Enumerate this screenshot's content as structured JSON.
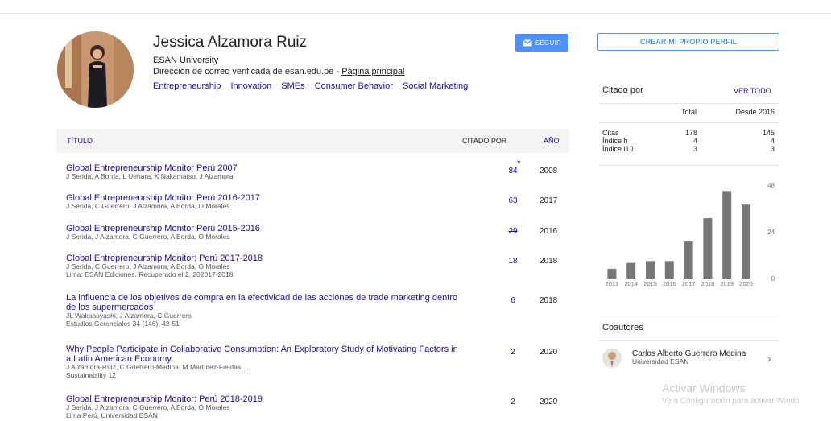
{
  "profile": {
    "name": "Jessica Alzamora Ruiz",
    "affiliation": "ESAN University",
    "email_text": "Dirección de correo verificada de esan.edu.pe - ",
    "homepage_label": "Página principal",
    "interests": [
      "Entrepreneurship",
      "Innovation",
      "SMEs",
      "Consumer Behavior",
      "Social Marketing"
    ],
    "follow_label": "SEGUIR"
  },
  "table": {
    "col_title": "TÍTULO",
    "col_cited": "CITADO POR",
    "col_year": "AÑO",
    "rows": [
      {
        "title": "Global Entrepreneurship Monitor Perú 2007",
        "authors": "J Serida, A Borda, L Uehara, K Nakamatsu, J Alzamora",
        "source": "",
        "cited": "84",
        "star": "*",
        "year": "2008"
      },
      {
        "title": "Global Entrepreneurship Monitor Perú 2016-2017",
        "authors": "J Serida, C Guerrero, J Alzamora, A Borda, O Morales",
        "source": "",
        "cited": "63",
        "year": "2017"
      },
      {
        "title": "Global Entrepreneurship Monitor Perú 2015-2016",
        "authors": "J Serida, J Alzamora, C Guerrero, A Borda, O Morales",
        "source": "",
        "cited": "29",
        "year": "2016"
      },
      {
        "title": "Global Entrepreneurship Monitor: Perú 2017-2018",
        "authors": "J Serida, C Guerrero, J Alzamora, A Borda, O Morales",
        "source": "Lima: ESAN Ediciones. Recuperado el 2, 202017-2018",
        "cited": "18",
        "year": "2018"
      },
      {
        "title": "La influencia de los objetivos de compra en la efectividad de las acciones de trade marketing dentro de los supermercados",
        "authors": "JL Wakabayashi, J Alzamora, C Guerrero",
        "source": "Estudios Gerenciales 34 (146), 42-51",
        "cited": "6",
        "year": "2018"
      },
      {
        "title": "Why People Participate in Collaborative Consumption: An Exploratory Study of Motivating Factors in a Latin American Economy",
        "authors": "J Alzamora-Ruiz, C Guerrero-Medina, M Martínez-Fiestas, ...",
        "source": "Sustainability 12",
        "cited": "2",
        "year": "2020"
      },
      {
        "title": "Global Entrepreneurship Monitor: Perú 2018-2019",
        "authors": "J Serida, J Alzamora, C Guerrero, A Borda, O Morales",
        "source": "Lima Perú, Universidad ESAN",
        "cited": "2",
        "year": "2020"
      }
    ]
  },
  "sidebar": {
    "create_label": "CREAR MI PROPIO PERFIL",
    "cited_by_title": "Citado por",
    "see_all_label": "VER TODO",
    "col_total": "Total",
    "col_since": "Desde 2016",
    "stats": [
      {
        "label": "Citas",
        "total": "178",
        "since": "145"
      },
      {
        "label": "Índice h",
        "total": "4",
        "since": "4"
      },
      {
        "label": "Índice i10",
        "total": "3",
        "since": "3"
      }
    ],
    "coauthors_title": "Coautores",
    "coauthor_name": "Carlos Alberto Guerrero Medina",
    "coauthor_org": "Universidad ESAN"
  },
  "chart_data": {
    "type": "bar",
    "categories": [
      "2013",
      "2014",
      "2015",
      "2016",
      "2017",
      "2018",
      "2019",
      "2020"
    ],
    "values": [
      5,
      8,
      9,
      9,
      19,
      31,
      45,
      38
    ],
    "ylim": [
      0,
      48
    ],
    "yticks": [
      "48",
      "24",
      "0"
    ],
    "y_axis_side": "right",
    "grid": false,
    "bar_color": "#777777"
  },
  "watermark": {
    "line1": "Activar Windows",
    "line2": "Ve a Configuración para activar Windo"
  }
}
